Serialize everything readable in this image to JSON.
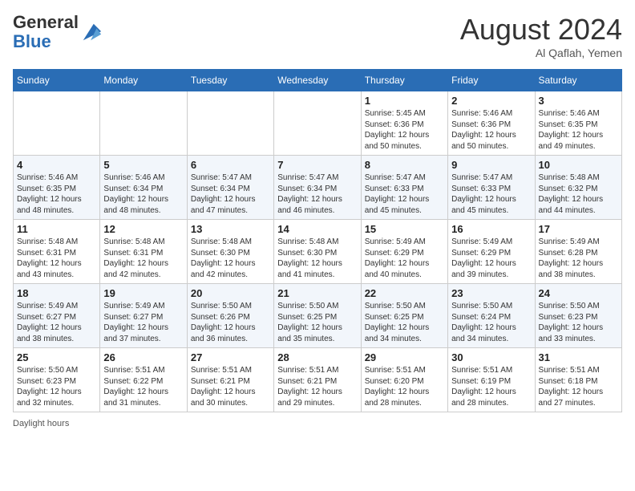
{
  "header": {
    "logo_line1": "General",
    "logo_line2": "Blue",
    "month_title": "August 2024",
    "location": "Al Qaflah, Yemen"
  },
  "weekdays": [
    "Sunday",
    "Monday",
    "Tuesday",
    "Wednesday",
    "Thursday",
    "Friday",
    "Saturday"
  ],
  "weeks": [
    [
      {
        "day": "",
        "info": ""
      },
      {
        "day": "",
        "info": ""
      },
      {
        "day": "",
        "info": ""
      },
      {
        "day": "",
        "info": ""
      },
      {
        "day": "1",
        "info": "Sunrise: 5:45 AM\nSunset: 6:36 PM\nDaylight: 12 hours\nand 50 minutes."
      },
      {
        "day": "2",
        "info": "Sunrise: 5:46 AM\nSunset: 6:36 PM\nDaylight: 12 hours\nand 50 minutes."
      },
      {
        "day": "3",
        "info": "Sunrise: 5:46 AM\nSunset: 6:35 PM\nDaylight: 12 hours\nand 49 minutes."
      }
    ],
    [
      {
        "day": "4",
        "info": "Sunrise: 5:46 AM\nSunset: 6:35 PM\nDaylight: 12 hours\nand 48 minutes."
      },
      {
        "day": "5",
        "info": "Sunrise: 5:46 AM\nSunset: 6:34 PM\nDaylight: 12 hours\nand 48 minutes."
      },
      {
        "day": "6",
        "info": "Sunrise: 5:47 AM\nSunset: 6:34 PM\nDaylight: 12 hours\nand 47 minutes."
      },
      {
        "day": "7",
        "info": "Sunrise: 5:47 AM\nSunset: 6:34 PM\nDaylight: 12 hours\nand 46 minutes."
      },
      {
        "day": "8",
        "info": "Sunrise: 5:47 AM\nSunset: 6:33 PM\nDaylight: 12 hours\nand 45 minutes."
      },
      {
        "day": "9",
        "info": "Sunrise: 5:47 AM\nSunset: 6:33 PM\nDaylight: 12 hours\nand 45 minutes."
      },
      {
        "day": "10",
        "info": "Sunrise: 5:48 AM\nSunset: 6:32 PM\nDaylight: 12 hours\nand 44 minutes."
      }
    ],
    [
      {
        "day": "11",
        "info": "Sunrise: 5:48 AM\nSunset: 6:31 PM\nDaylight: 12 hours\nand 43 minutes."
      },
      {
        "day": "12",
        "info": "Sunrise: 5:48 AM\nSunset: 6:31 PM\nDaylight: 12 hours\nand 42 minutes."
      },
      {
        "day": "13",
        "info": "Sunrise: 5:48 AM\nSunset: 6:30 PM\nDaylight: 12 hours\nand 42 minutes."
      },
      {
        "day": "14",
        "info": "Sunrise: 5:48 AM\nSunset: 6:30 PM\nDaylight: 12 hours\nand 41 minutes."
      },
      {
        "day": "15",
        "info": "Sunrise: 5:49 AM\nSunset: 6:29 PM\nDaylight: 12 hours\nand 40 minutes."
      },
      {
        "day": "16",
        "info": "Sunrise: 5:49 AM\nSunset: 6:29 PM\nDaylight: 12 hours\nand 39 minutes."
      },
      {
        "day": "17",
        "info": "Sunrise: 5:49 AM\nSunset: 6:28 PM\nDaylight: 12 hours\nand 38 minutes."
      }
    ],
    [
      {
        "day": "18",
        "info": "Sunrise: 5:49 AM\nSunset: 6:27 PM\nDaylight: 12 hours\nand 38 minutes."
      },
      {
        "day": "19",
        "info": "Sunrise: 5:49 AM\nSunset: 6:27 PM\nDaylight: 12 hours\nand 37 minutes."
      },
      {
        "day": "20",
        "info": "Sunrise: 5:50 AM\nSunset: 6:26 PM\nDaylight: 12 hours\nand 36 minutes."
      },
      {
        "day": "21",
        "info": "Sunrise: 5:50 AM\nSunset: 6:25 PM\nDaylight: 12 hours\nand 35 minutes."
      },
      {
        "day": "22",
        "info": "Sunrise: 5:50 AM\nSunset: 6:25 PM\nDaylight: 12 hours\nand 34 minutes."
      },
      {
        "day": "23",
        "info": "Sunrise: 5:50 AM\nSunset: 6:24 PM\nDaylight: 12 hours\nand 34 minutes."
      },
      {
        "day": "24",
        "info": "Sunrise: 5:50 AM\nSunset: 6:23 PM\nDaylight: 12 hours\nand 33 minutes."
      }
    ],
    [
      {
        "day": "25",
        "info": "Sunrise: 5:50 AM\nSunset: 6:23 PM\nDaylight: 12 hours\nand 32 minutes."
      },
      {
        "day": "26",
        "info": "Sunrise: 5:51 AM\nSunset: 6:22 PM\nDaylight: 12 hours\nand 31 minutes."
      },
      {
        "day": "27",
        "info": "Sunrise: 5:51 AM\nSunset: 6:21 PM\nDaylight: 12 hours\nand 30 minutes."
      },
      {
        "day": "28",
        "info": "Sunrise: 5:51 AM\nSunset: 6:21 PM\nDaylight: 12 hours\nand 29 minutes."
      },
      {
        "day": "29",
        "info": "Sunrise: 5:51 AM\nSunset: 6:20 PM\nDaylight: 12 hours\nand 28 minutes."
      },
      {
        "day": "30",
        "info": "Sunrise: 5:51 AM\nSunset: 6:19 PM\nDaylight: 12 hours\nand 28 minutes."
      },
      {
        "day": "31",
        "info": "Sunrise: 5:51 AM\nSunset: 6:18 PM\nDaylight: 12 hours\nand 27 minutes."
      }
    ]
  ],
  "footer": "Daylight hours"
}
